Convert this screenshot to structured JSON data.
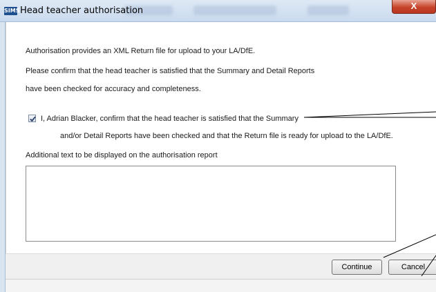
{
  "window": {
    "title": "Head teacher authorisation",
    "app_badge": "SIMS",
    "close_glyph": "X"
  },
  "body": {
    "intro": "Authorisation provides an XML Return file for upload to your LA/DfE.",
    "confirm_line1": "Please confirm that the head teacher is satisfied that the Summary and Detail Reports",
    "confirm_line2": "have been checked for accuracy and completeness.",
    "checkbox_checked": true,
    "checkbox_line1": "I, Adrian Blacker, confirm that the head teacher is satisfied that the Summary",
    "checkbox_line2": "and/or Detail Reports have been checked and that the Return file is ready for upload to the LA/DfE.",
    "additional_label": "Additional text to be displayed on the authorisation report",
    "additional_value": ""
  },
  "buttons": {
    "continue": "Continue",
    "cancel": "Cancel"
  },
  "icons": {
    "check": "checkmark-icon",
    "close": "close-icon"
  }
}
